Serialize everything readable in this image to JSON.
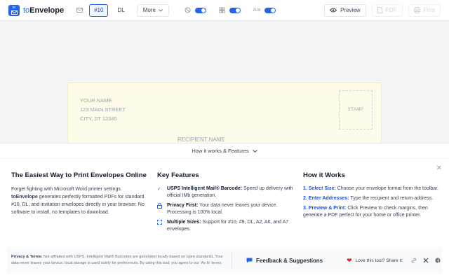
{
  "app": {
    "logo_small": "to",
    "brand_prefix": "to",
    "brand_name": "Envelope"
  },
  "toolbar": {
    "formats": [
      "#10",
      "DL"
    ],
    "active_format": "#10",
    "more_label": "More",
    "toggle3_label": "A/a",
    "preview_label": "Preview",
    "pdf_label": "PDF",
    "print_label": "Print"
  },
  "envelope": {
    "return_lines": [
      "YOUR NAME",
      "123 MAIN STREET",
      "CITY, ST 12345"
    ],
    "stamp_label": "STAMP",
    "recipient_label": "RECIPIENT NAME",
    "background_color": "#fefce8"
  },
  "panel": {
    "toggle_label": "How it works & Features",
    "col1": {
      "title": "The Easiest Way to Print Envelopes Online",
      "p1": "Forget fighting with Microsoft Word printer settings.",
      "p2_bold": "toEnvelope",
      "p2_rest": " generates perfectly formatted PDFs for standard #10, DL, and invitation envelopes directly in your browser. No software to install, no templates to download."
    },
    "col2": {
      "title": "Key Features",
      "features": [
        {
          "icon": "check-icon",
          "title": "USPS Intelligent Mail® Barcode:",
          "text": " Speed up delivery with official IMb generation."
        },
        {
          "icon": "lock-icon",
          "title": "Privacy First:",
          "text": " Your data never leaves your device. Processing is 100% local."
        },
        {
          "icon": "expand-icon",
          "title": "Multiple Sizes:",
          "text": " Support for #10, #9, DL, A2, A6, and A7 envelopes."
        }
      ]
    },
    "col3": {
      "title": "How it Works",
      "steps": [
        {
          "title": "1. Select Size:",
          "text": " Choose your envelope format from the toolbar."
        },
        {
          "title": "2. Enter Addresses:",
          "text": " Type the recipient and return address."
        },
        {
          "title": "3. Preview & Print:",
          "text": " Click Preview to check margins, then generate a PDF perfect for your home or office printer."
        }
      ]
    },
    "footer": {
      "legal_bold": "Privacy & Terms:",
      "legal_text": " Not affiliated with USPS. Intelligent Mail® Barcodes are generated locally based on open standards. Your data never leaves your device, local storage is used solely for preferences. By using this tool, you agree to our 'As Is' terms.",
      "feedback_label": "Feedback & Suggestions",
      "share_label": "Love this tool? Share it:"
    }
  },
  "colors": {
    "accent": "#2563eb",
    "envelope": "#fefce8"
  }
}
